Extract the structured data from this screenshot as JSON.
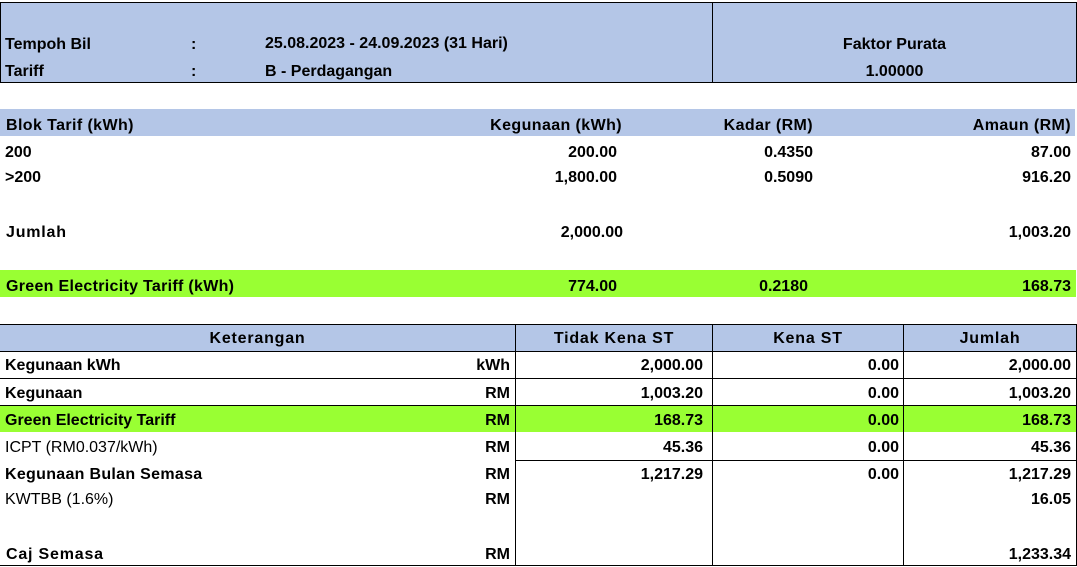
{
  "header": {
    "tempoh_label": "Tempoh Bil",
    "tariff_label": "Tariff",
    "colon": ":",
    "tempoh_value": "25.08.2023 - 24.09.2023 (31 Hari)",
    "tariff_value": "B - Perdagangan",
    "faktor_label": "Faktor Purata",
    "faktor_value": "1.00000"
  },
  "blocks": {
    "headers": [
      "Blok Tarif (kWh)",
      "Kegunaan (kWh)",
      "Kadar (RM)",
      "Amaun (RM)"
    ],
    "rows": [
      [
        "200",
        "200.00",
        "0.4350",
        "87.00"
      ],
      [
        ">200",
        "1,800.00",
        "0.5090",
        "916.20"
      ]
    ],
    "total": {
      "label": "Jumlah",
      "kegunaan": "2,000.00",
      "amaun": "1,003.20"
    },
    "green": {
      "label": "Green Electricity Tariff (kWh)",
      "kegunaan": "774.00",
      "kadar": "0.2180",
      "amaun": "168.73"
    }
  },
  "summary": {
    "headers": [
      "Keterangan",
      "Tidak Kena ST",
      "Kena ST",
      "Jumlah"
    ],
    "rows": [
      {
        "label": "Kegunaan kWh",
        "unit": "kWh",
        "tidak": "2,000.00",
        "kena": "0.00",
        "jumlah": "2,000.00"
      },
      {
        "label": "Kegunaan",
        "unit": "RM",
        "tidak": "1,003.20",
        "kena": "0.00",
        "jumlah": "1,003.20"
      },
      {
        "label": "Green Electricity Tariff",
        "unit": "RM",
        "tidak": "168.73",
        "kena": "0.00",
        "jumlah": "168.73"
      },
      {
        "label": "ICPT (RM0.037/kWh)",
        "unit": "RM",
        "tidak": "45.36",
        "kena": "0.00",
        "jumlah": "45.36"
      },
      {
        "label": "Kegunaan Bulan Semasa",
        "unit": "RM",
        "tidak": "1,217.29",
        "kena": "0.00",
        "jumlah": "1,217.29"
      },
      {
        "label": "KWTBB (1.6%)",
        "unit": "RM",
        "tidak": "",
        "kena": "",
        "jumlah": "16.05"
      }
    ],
    "caj": {
      "label": "Caj Semasa",
      "unit": "RM",
      "jumlah": "1,233.34"
    }
  }
}
